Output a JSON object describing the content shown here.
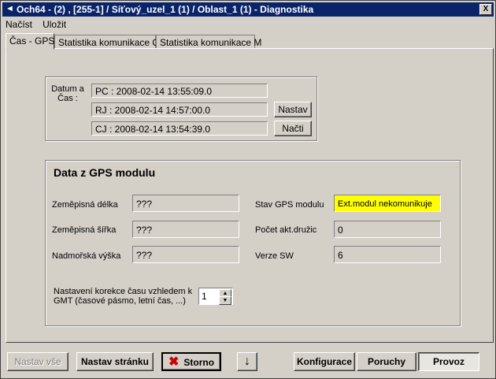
{
  "window": {
    "title": "Och64 - (2) , [255-1] / Síťový_uzel_1 (1) / Oblast_1 (1) - Diagnostika",
    "close_label": "X"
  },
  "menu": {
    "items": [
      "Načíst",
      "Uložit"
    ]
  },
  "tabs": [
    "Čas - GPS",
    "Statistika komunikace Q",
    "Statistika komunikace M"
  ],
  "time": {
    "label": "Datum a Čas :",
    "pc": "PC : 2008-02-14 13:55:09.0",
    "rj": "RJ : 2008-02-14 14:57:00.0",
    "cj": "CJ : 2008-02-14 13:54:39.0",
    "set_button": "Nastav",
    "load_button": "Načti"
  },
  "gps": {
    "title": "Data z GPS modulu",
    "longitude_label": "Zeměpisná délka",
    "longitude_value": "???",
    "latitude_label": "Zeměpisná šířka",
    "latitude_value": "???",
    "altitude_label": "Nadmořská výška",
    "altitude_value": "???",
    "status_label": "Stav GPS modulu",
    "status_value": "Ext.modul nekomunikuje",
    "status_color": "#ffff00",
    "satellites_label": "Počet akt.družic",
    "satellites_value": "0",
    "sw_label": "Verze SW",
    "sw_value": "6",
    "correction_label": "Nastavení korekce času vzhledem k GMT  (časové pásmo, letní čas, ...)",
    "correction_value": "1"
  },
  "buttons": {
    "set_all": "Nastav vše",
    "set_page": "Nastav stránku",
    "cancel": "Storno",
    "down": "↓",
    "config": "Konfigurace",
    "faults": "Poruchy",
    "operation": "Provoz"
  }
}
